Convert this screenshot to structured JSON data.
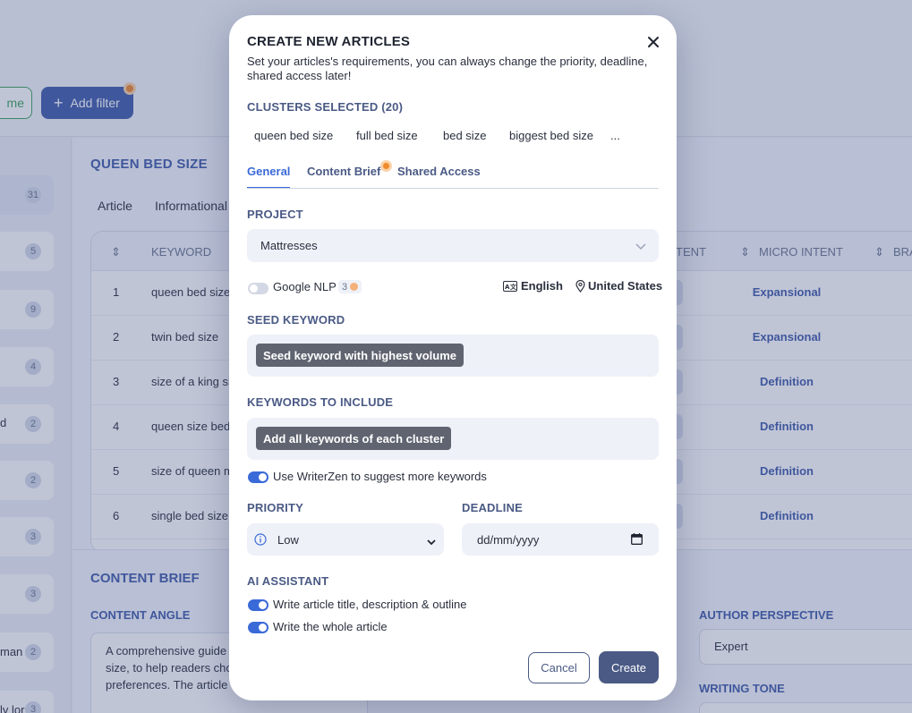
{
  "background": {
    "name_button_label": "me",
    "add_filter_label": "Add filter",
    "left_column": {
      "badges": [
        "31",
        "5",
        "9",
        "4",
        "2",
        "2",
        "3",
        "3",
        "2",
        "3"
      ],
      "partial_texts": [
        "d",
        "man",
        "ly lor"
      ]
    },
    "main": {
      "title": "QUEEN BED SIZE",
      "tabs": [
        "Article",
        "Informational"
      ],
      "columns": [
        "KEYWORD",
        "INTENT",
        "MICRO INTENT",
        "BRA"
      ],
      "rows": [
        {
          "num": "1",
          "keyword": "queen bed size",
          "micro_intent": "Expansional"
        },
        {
          "num": "2",
          "keyword": "twin bed size",
          "micro_intent": "Expansional"
        },
        {
          "num": "3",
          "keyword": "size of a king si",
          "micro_intent": "Definition"
        },
        {
          "num": "4",
          "keyword": "queen size bed",
          "micro_intent": "Definition"
        },
        {
          "num": "5",
          "keyword": "size of queen m",
          "micro_intent": "Definition"
        },
        {
          "num": "6",
          "keyword": "single bed size",
          "micro_intent": "Definition"
        }
      ]
    },
    "brief": {
      "title": "CONTENT BRIEF",
      "content_angle_label": "CONTENT ANGLE",
      "content_angle_text": "A comprehensive guide including the dimension size, to help readers choo their needs and preferences. The article will also",
      "author_perspective_label": "AUTHOR PERSPECTIVE",
      "author_perspective_value": "Expert",
      "writing_tone_label": "WRITING TONE"
    }
  },
  "modal": {
    "title": "CREATE NEW ARTICLES",
    "description": "Set your articles's requirements, you can always change the priority, deadline, shared access later!",
    "clusters_label": "CLUSTERS SELECTED (20)",
    "clusters": [
      "queen bed size",
      "full bed size",
      "bed size",
      "biggest bed size",
      "..."
    ],
    "tabs": [
      "General",
      "Content Brief",
      "Shared Access"
    ],
    "active_tab": "General",
    "project_label": "PROJECT",
    "project_value": "Mattresses",
    "google_nlp_label": "Google NLP",
    "google_nlp_credits": "3",
    "google_nlp_enabled": false,
    "language": "English",
    "location": "United States",
    "seed_keyword_label": "SEED KEYWORD",
    "seed_keyword_token": "Seed keyword with highest volume",
    "keywords_include_label": "KEYWORDS TO INCLUDE",
    "keywords_include_token": "Add all keywords of each cluster",
    "suggest_keywords_label": "Use WriterZen to suggest more keywords",
    "suggest_keywords_enabled": true,
    "priority_label": "PRIORITY",
    "priority_value": "Low",
    "deadline_label": "DEADLINE",
    "deadline_placeholder": "dd/mm/yyyy",
    "ai_assistant_label": "AI ASSISTANT",
    "ai_options": [
      {
        "label": "Write article title, description & outline",
        "enabled": true
      },
      {
        "label": "Write the whole article",
        "enabled": true
      }
    ],
    "cancel_label": "Cancel",
    "create_label": "Create"
  },
  "colors": {
    "accent": "#3a6ad8",
    "primary_button": "#4a5a85",
    "notification_dot": "#f08a2c"
  }
}
